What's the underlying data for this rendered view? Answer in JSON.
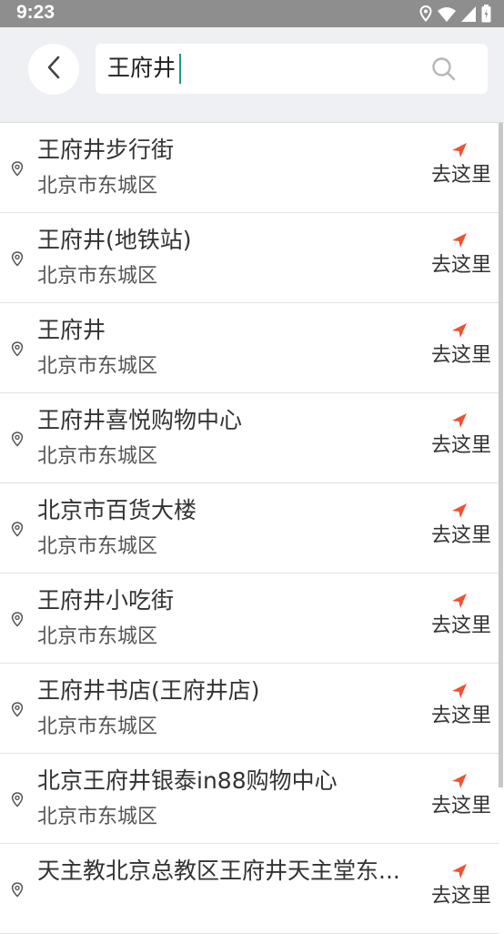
{
  "status_bar": {
    "time": "9:23",
    "icons": [
      "location-icon",
      "wifi-icon",
      "signal-icon",
      "battery-icon"
    ]
  },
  "header": {
    "back_icon": "back-arrow-icon",
    "search": {
      "value": "王府井",
      "icon": "search-icon"
    }
  },
  "results": [
    {
      "title": "王府井步行街",
      "subtitle": "北京市东城区",
      "action": "去这里"
    },
    {
      "title": "王府井(地铁站)",
      "subtitle": "北京市东城区",
      "action": "去这里"
    },
    {
      "title": "王府井",
      "subtitle": "北京市东城区",
      "action": "去这里"
    },
    {
      "title": "王府井喜悦购物中心",
      "subtitle": "北京市东城区",
      "action": "去这里"
    },
    {
      "title": "北京市百货大楼",
      "subtitle": "北京市东城区",
      "action": "去这里"
    },
    {
      "title": "王府井小吃街",
      "subtitle": "北京市东城区",
      "action": "去这里"
    },
    {
      "title": "王府井书店(王府井店)",
      "subtitle": "北京市东城区",
      "action": "去这里"
    },
    {
      "title": "北京王府井银泰in88购物中心",
      "subtitle": "北京市东城区",
      "action": "去这里"
    },
    {
      "title": "天主教北京总教区王府井天主堂东...",
      "subtitle": "",
      "action": "去这里"
    }
  ],
  "colors": {
    "status_bar": "#8e8e8e",
    "header_bg": "#eef0f4",
    "accent_arrow": "#f0512e",
    "caret": "#1c9a86"
  }
}
